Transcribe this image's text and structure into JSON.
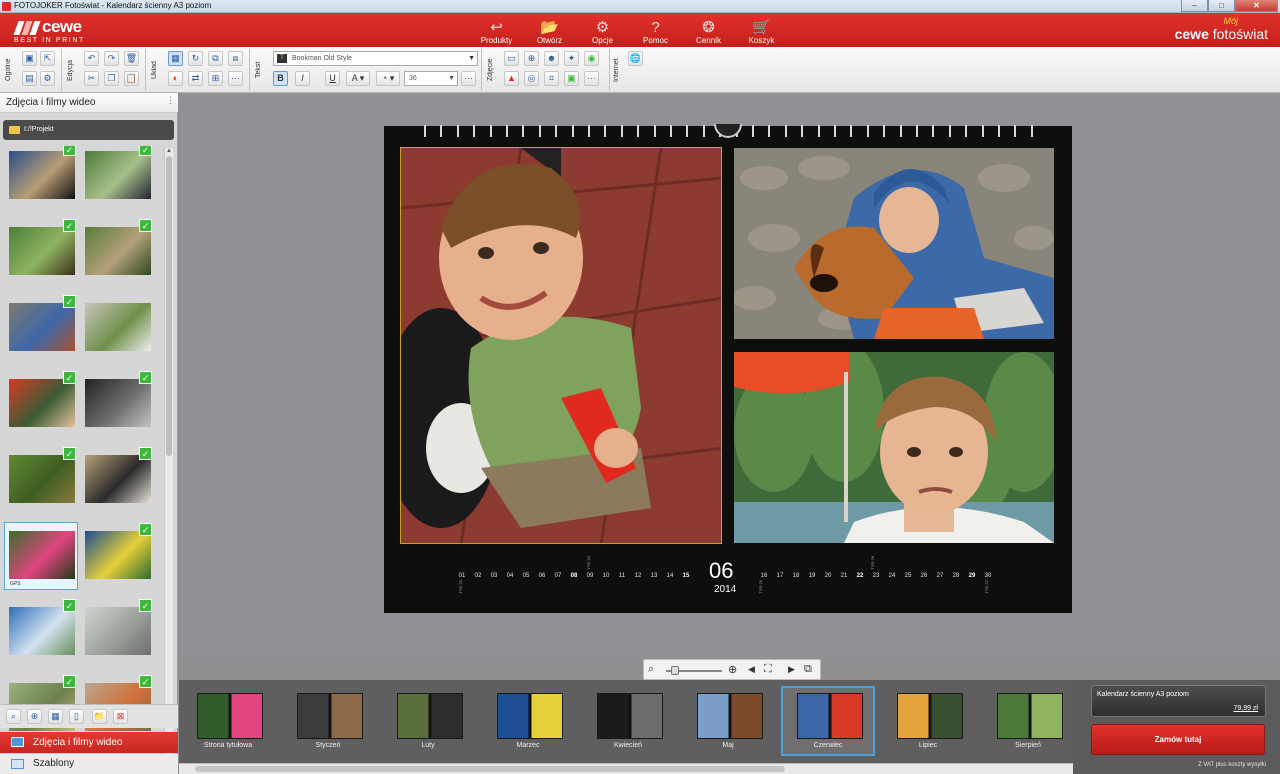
{
  "window": {
    "title": "FOTOJOKER Fotoświat - Kalendarz ścienny A3 poziom",
    "buttons": [
      "–",
      "□",
      "✕"
    ]
  },
  "brand": {
    "logo": "cewe",
    "tagline": "BEST IN PRINT",
    "right_small": "Mój",
    "right_bold": "cewe",
    "right_light": "fotoświat"
  },
  "colors": {
    "brand_red": "#d92a25",
    "selection_blue": "#4aa3e0",
    "check_green": "#3fb640"
  },
  "menu": [
    {
      "label": "Produkty",
      "icon": "arrow-icon",
      "glyph": "↩"
    },
    {
      "label": "Otwórz",
      "icon": "folder-open-icon",
      "glyph": "📂"
    },
    {
      "label": "Opcje",
      "icon": "gear-icon",
      "glyph": "⚙"
    },
    {
      "label": "Pomoc",
      "icon": "help-icon",
      "glyph": "?"
    },
    {
      "label": "Cennik",
      "icon": "coins-icon",
      "glyph": "❂"
    },
    {
      "label": "Koszyk",
      "icon": "cart-icon",
      "glyph": "🛒"
    }
  ],
  "toolbar": {
    "groups": [
      "Ogólne",
      "Edycja",
      "Układ",
      "Tekst",
      "Zdjęcie",
      "Internet"
    ],
    "font": "Bookman Old Style",
    "font_size": "36",
    "bold": "B",
    "italic": "I",
    "underline": "U",
    "text_color": "A"
  },
  "left_panel": {
    "title": "Zdjęcia i filmy wideo",
    "folder": "I:/!Projekt",
    "gps_label": "GPS",
    "tabs": [
      {
        "label": "Zdjęcia i filmy wideo",
        "active": true
      },
      {
        "label": "Szablony",
        "active": false
      }
    ]
  },
  "thumbnails": [
    {
      "colors": [
        "#2a4f8a",
        "#b89d74",
        "#111"
      ],
      "checked": true
    },
    {
      "colors": [
        "#4d7a39",
        "#a7c08a",
        "#223"
      ],
      "checked": true
    },
    {
      "colors": [
        "#4b7f3b",
        "#8fb35f",
        "#3a2f1c"
      ],
      "checked": true
    },
    {
      "colors": [
        "#587d3a",
        "#b4a07a",
        "#2e4a1e"
      ],
      "checked": true
    },
    {
      "colors": [
        "#7c7a72",
        "#3e67a9",
        "#a8532f"
      ],
      "checked": true
    },
    {
      "colors": [
        "#c9c6bb",
        "#6e8f4a",
        "#eee"
      ],
      "checked": false
    },
    {
      "colors": [
        "#d83a25",
        "#3a5c35",
        "#e3c29c"
      ],
      "checked": true
    },
    {
      "colors": [
        "#222",
        "#6d6d6d",
        "#c3c3c3"
      ],
      "checked": true
    },
    {
      "colors": [
        "#5f8a32",
        "#3e5e23",
        "#8a7b3e"
      ],
      "checked": true
    },
    {
      "colors": [
        "#b7a177",
        "#2a2a2a",
        "#e6e1d8"
      ],
      "checked": true
    },
    {
      "colors": [
        "#3c6e2d",
        "#e0457f",
        "#1d3b18"
      ],
      "checked": false,
      "selected": true,
      "gps": true
    },
    {
      "colors": [
        "#1c4d92",
        "#e6d13a",
        "#2f6a2f"
      ],
      "checked": true
    },
    {
      "colors": [
        "#2c6fb6",
        "#d3e2f1",
        "#6a8f5a"
      ],
      "checked": true
    },
    {
      "colors": [
        "#cfd3cf",
        "#9aa19a",
        "#6c6c6c"
      ],
      "checked": true
    },
    {
      "colors": [
        "#9bb27c",
        "#6c7f4e",
        "#c9b57e"
      ],
      "checked": true
    },
    {
      "colors": [
        "#b8a88f",
        "#d26f3a",
        "#7c6a4d"
      ],
      "checked": true
    }
  ],
  "calendar": {
    "month": "06",
    "year": "2014",
    "days": [
      "01",
      "02",
      "03",
      "04",
      "05",
      "06",
      "07",
      "08",
      "09",
      "10",
      "11",
      "12",
      "13",
      "14",
      "15",
      "16",
      "17",
      "18",
      "19",
      "20",
      "21",
      "22",
      "23",
      "24",
      "25",
      "26",
      "27",
      "28",
      "29",
      "30"
    ],
    "bold_days": [
      "08",
      "15",
      "22",
      "29"
    ],
    "week_marks": [
      "TYD 23",
      "TYD 24",
      "TYD 25",
      "TYD 26",
      "TYD 27"
    ]
  },
  "filmstrip": [
    {
      "label": "Strona tytułowa",
      "colors": [
        "#2f5d2a",
        "#e0457f"
      ],
      "selected": false
    },
    {
      "label": "Styczeń",
      "colors": [
        "#3b3b3b",
        "#8c6a4a"
      ],
      "selected": false
    },
    {
      "label": "Luty",
      "colors": [
        "#5a6e3c",
        "#2d2d2d"
      ],
      "selected": false
    },
    {
      "label": "Marzec",
      "colors": [
        "#1c4d92",
        "#e6d13a"
      ],
      "selected": false
    },
    {
      "label": "Kwiecień",
      "colors": [
        "#1b1b1b",
        "#6d6d6d"
      ],
      "selected": false
    },
    {
      "label": "Maj",
      "colors": [
        "#7a9ec7",
        "#7c4a2a"
      ],
      "selected": false
    },
    {
      "label": "Czerwiec",
      "colors": [
        "#3e67a9",
        "#d83a25"
      ],
      "selected": true
    },
    {
      "label": "Lipiec",
      "colors": [
        "#e2a23c",
        "#3a4f2f"
      ],
      "selected": false
    },
    {
      "label": "Sierpień",
      "colors": [
        "#4a7b39",
        "#8fb35f"
      ],
      "selected": false
    }
  ],
  "order": {
    "product": "Kalendarz ścienny A3 poziom",
    "price": "79,99 zł",
    "button": "Zamów tutaj",
    "vat_note": "Z VAT plus koszty wysyłki"
  }
}
